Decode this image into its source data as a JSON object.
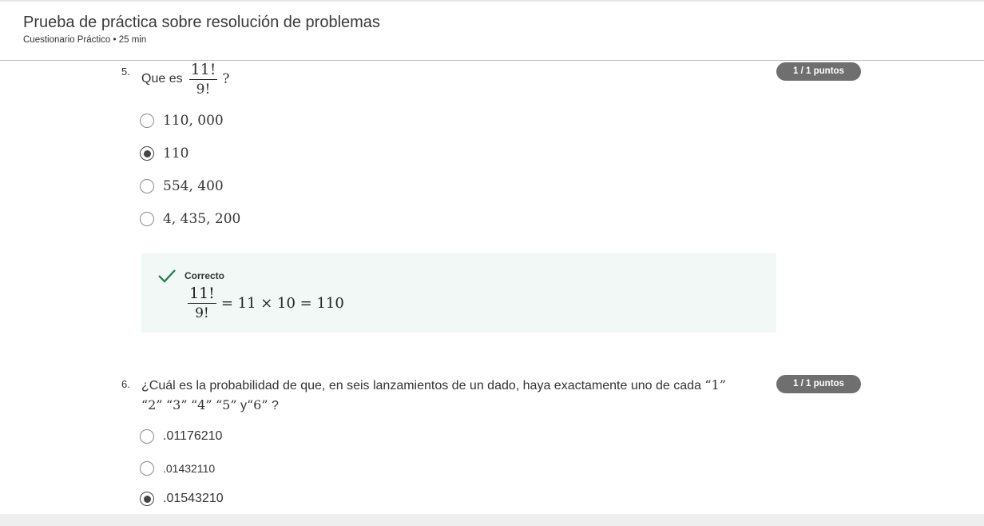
{
  "header": {
    "title": "Prueba de práctica sobre resolución de problemas",
    "subtitle": "Cuestionario Práctico • 25 min"
  },
  "question5": {
    "number": "5.",
    "prefix": "Que es",
    "frac_num": "11!",
    "frac_den": "9!",
    "suffix": "?",
    "badge": "1 / 1 puntos",
    "options": [
      {
        "label": "110, 000",
        "selected": false
      },
      {
        "label": "110",
        "selected": true
      },
      {
        "label": "554, 400",
        "selected": false
      },
      {
        "label": "4, 435, 200",
        "selected": false
      }
    ],
    "feedback": {
      "title": "Correcto",
      "frac_num": "11!",
      "frac_den": "9!",
      "rest": "= 11 × 10 = 110"
    }
  },
  "question6": {
    "number": "6.",
    "line1": "¿Cuál es la probabilidad de que, en seis lanzamientos de un dado, haya exactamente uno de cada",
    "q1": "“1”",
    "q2": "“2”",
    "q3": "“3”",
    "q4": "“4”",
    "q5": "“5”",
    "and": "y",
    "q6": "“6”",
    "end": "?",
    "badge": "1 / 1 puntos",
    "options": [
      {
        "label": ".01176210",
        "selected": false
      },
      {
        "label": ".01432110",
        "selected": false
      },
      {
        "label": ".01543210",
        "selected": true
      }
    ]
  },
  "icons": {
    "check_color": "#1e7b4a"
  }
}
